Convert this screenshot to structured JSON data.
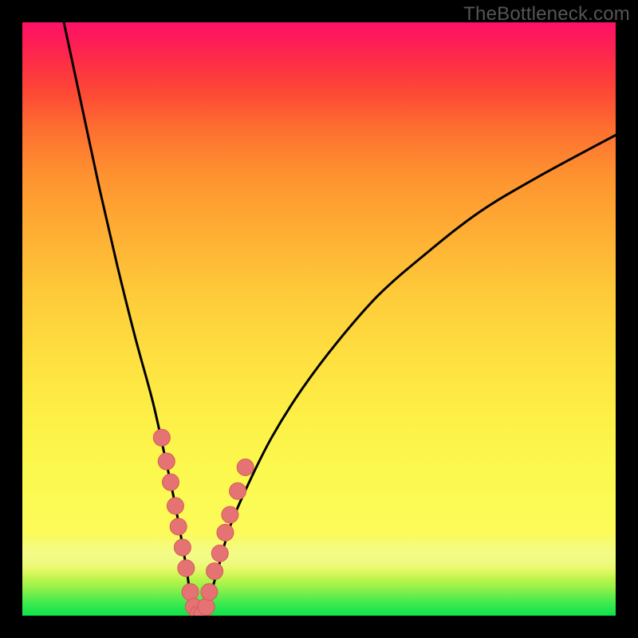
{
  "watermark": "TheBottleneck.com",
  "colors": {
    "frame": "#000000",
    "curve": "#000000",
    "marker_fill": "#e57373",
    "marker_stroke": "#d45a5a"
  },
  "chart_data": {
    "type": "line",
    "title": "",
    "xlabel": "",
    "ylabel": "",
    "xlim": [
      0,
      100
    ],
    "ylim": [
      0,
      100
    ],
    "series": [
      {
        "name": "bottleneck-curve",
        "x": [
          7,
          10,
          13,
          16,
          19,
          22,
          24,
          25.5,
          26.8,
          27.8,
          28.5,
          29.2,
          30,
          31.5,
          33,
          35,
          38,
          42,
          47,
          53,
          60,
          68,
          77,
          87,
          100
        ],
        "y": [
          100,
          86,
          72,
          59,
          47,
          36,
          27,
          20,
          13,
          7,
          2,
          0,
          0,
          3,
          8,
          15,
          22,
          30,
          38,
          46,
          54,
          61,
          68,
          74,
          81
        ]
      }
    ],
    "markers": {
      "name": "sample-points",
      "x": [
        23.5,
        24.3,
        25.0,
        25.8,
        26.3,
        27.0,
        27.6,
        28.3,
        28.9,
        29.6,
        30.3,
        31.0,
        31.5,
        32.4,
        33.3,
        34.2,
        35.0,
        36.3,
        37.6
      ],
      "y": [
        30.0,
        26.0,
        22.5,
        18.5,
        15.0,
        11.5,
        8.0,
        4.0,
        1.5,
        0.2,
        0.2,
        1.5,
        4.0,
        7.5,
        10.5,
        14.0,
        17.0,
        21.0,
        25.0
      ]
    }
  }
}
